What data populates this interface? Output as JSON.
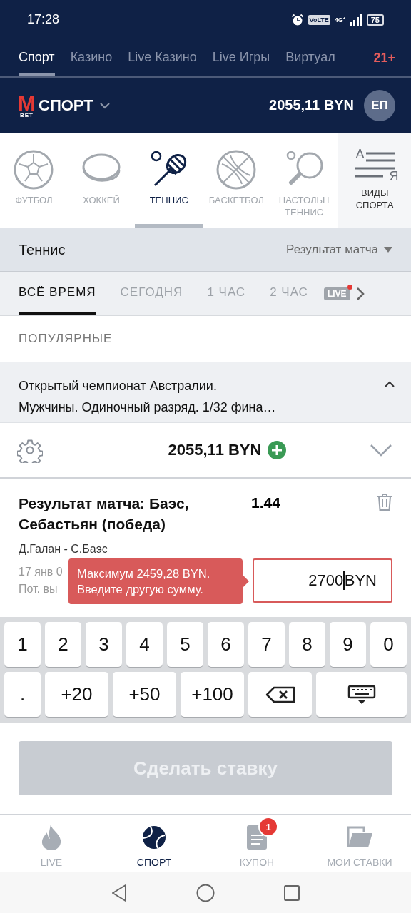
{
  "status_bar": {
    "time": "17:28",
    "volte": "VoLTE",
    "network": "4G⁺",
    "battery": "75"
  },
  "top_tabs": [
    {
      "label": "Спорт",
      "selected": true
    },
    {
      "label": "Казино",
      "selected": false
    },
    {
      "label": "Live Казино",
      "selected": false
    },
    {
      "label": "Live Игры",
      "selected": false
    },
    {
      "label": "Виртуал",
      "selected": false
    }
  ],
  "age_badge": "21+",
  "header": {
    "logo_letter": "M",
    "logo_sub": "BET",
    "section": "СПОРТ",
    "balance": "2055,11 BYN",
    "avatar": "ЕП"
  },
  "sports": [
    {
      "kind": "football",
      "label": "ФУТБОЛ",
      "selected": false
    },
    {
      "kind": "hockey",
      "label": "ХОККЕЙ",
      "selected": false
    },
    {
      "kind": "tennis",
      "label": "ТЕННИС",
      "selected": true
    },
    {
      "kind": "basketball",
      "label": "БАСКЕТБОЛ",
      "selected": false
    },
    {
      "kind": "tabletennis",
      "label": "НАСТОЛЬН\nТЕННИС",
      "selected": false
    }
  ],
  "all_sports": {
    "letter_a": "А",
    "letter_ya": "Я",
    "label": "ВИДЫ\nСПОРТА"
  },
  "filter_bar": {
    "title": "Теннис",
    "market": "Результат матча"
  },
  "time_filters": [
    {
      "label": "ВСЁ ВРЕМЯ",
      "selected": true
    },
    {
      "label": "СЕГОДНЯ",
      "selected": false
    },
    {
      "label": "1 ЧАС",
      "selected": false
    },
    {
      "label": "2 ЧАС",
      "selected": false
    }
  ],
  "live_badge": {
    "label": "LIVE",
    "active": true
  },
  "section_title": "ПОПУЛЯРНЫЕ",
  "tournament": {
    "title": "Открытый чемпионат Австралии.\nМужчины. Одиночный разряд. 1/32 фина…",
    "expanded": true
  },
  "betslip": {
    "balance": "2055,11 BYN",
    "expanded": false
  },
  "bet": {
    "title": "Результат матча: Баэс, Себастьян (победа)",
    "odds": "1.44",
    "match": "Д.Галан - С.Баэс",
    "date": "17 янв 0",
    "payout": "Пот. вы",
    "stake": "2700",
    "currency": "BYN",
    "error": "Максимум 2459,28 BYN.\nВведите другую сумму."
  },
  "keypad": [
    [
      "1",
      "2",
      "3",
      "4",
      "5",
      "6",
      "7",
      "8",
      "9",
      "0"
    ],
    [
      ".",
      "+20",
      "+50",
      "+100"
    ]
  ],
  "submit": {
    "label": "Сделать ставку",
    "disabled": true
  },
  "bottom_nav": [
    {
      "kind": "live",
      "label": "LIVE",
      "selected": false
    },
    {
      "kind": "sport",
      "label": "СПОРТ",
      "selected": true
    },
    {
      "kind": "coupon",
      "label": "КУПОН",
      "selected": false,
      "badge": "1"
    },
    {
      "kind": "mybets",
      "label": "МОИ СТАВКИ",
      "selected": false
    }
  ]
}
